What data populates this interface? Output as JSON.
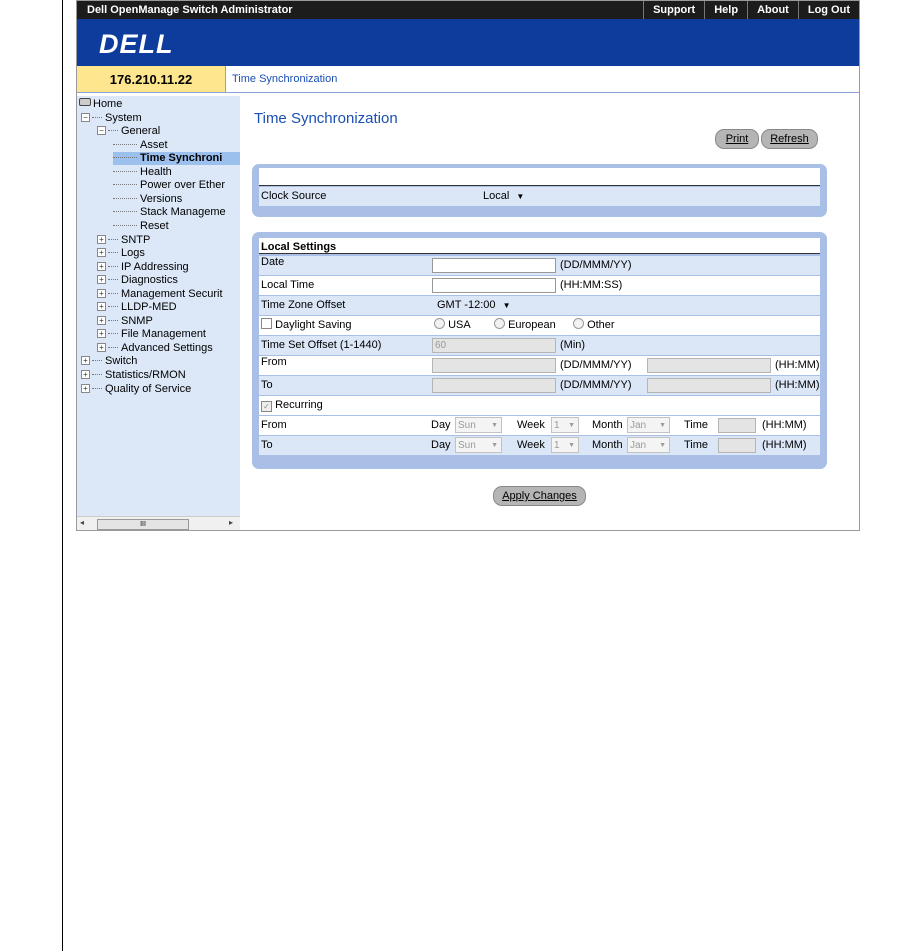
{
  "header": {
    "app_title": "Dell OpenManage Switch Administrator",
    "links": [
      "Support",
      "Help",
      "About",
      "Log Out"
    ],
    "logo_text": "DELL"
  },
  "ipbar": {
    "ip": "176.210.11.22",
    "breadcrumb": "Time Synchronization"
  },
  "tree": [
    {
      "label": "Home",
      "level": 0,
      "sign": "home"
    },
    {
      "label": "System",
      "level": 1,
      "sign": "-"
    },
    {
      "label": "General",
      "level": 2,
      "sign": "-"
    },
    {
      "label": "Asset",
      "level": 3,
      "sign": ""
    },
    {
      "label": "Time Synchroni",
      "level": 3,
      "sign": "",
      "selected": true
    },
    {
      "label": "Health",
      "level": 3,
      "sign": ""
    },
    {
      "label": "Power over Ether",
      "level": 3,
      "sign": ""
    },
    {
      "label": "Versions",
      "level": 3,
      "sign": ""
    },
    {
      "label": "Stack Manageme",
      "level": 3,
      "sign": ""
    },
    {
      "label": "Reset",
      "level": 3,
      "sign": ""
    },
    {
      "label": "SNTP",
      "level": 2,
      "sign": "+"
    },
    {
      "label": "Logs",
      "level": 2,
      "sign": "+"
    },
    {
      "label": "IP Addressing",
      "level": 2,
      "sign": "+"
    },
    {
      "label": "Diagnostics",
      "level": 2,
      "sign": "+"
    },
    {
      "label": "Management Securit",
      "level": 2,
      "sign": "+"
    },
    {
      "label": "LLDP-MED",
      "level": 2,
      "sign": "+"
    },
    {
      "label": "SNMP",
      "level": 2,
      "sign": "+"
    },
    {
      "label": "File Management",
      "level": 2,
      "sign": "+"
    },
    {
      "label": "Advanced Settings",
      "level": 2,
      "sign": "+"
    },
    {
      "label": "Switch",
      "level": 1,
      "sign": "+"
    },
    {
      "label": "Statistics/RMON",
      "level": 1,
      "sign": "+"
    },
    {
      "label": "Quality of Service",
      "level": 1,
      "sign": "+"
    }
  ],
  "scrollbar_thumb": "III",
  "page": {
    "title": "Time Synchronization",
    "print_label": "Print",
    "refresh_label": "Refresh",
    "apply_label": "Apply Changes"
  },
  "clock": {
    "label": "Clock Source",
    "value": "Local"
  },
  "local": {
    "heading": "Local Settings",
    "date_label": "Date",
    "date_unit": "(DD/MMM/YY)",
    "time_label": "Local Time",
    "time_unit": "(HH:MM:SS)",
    "tz_label": "Time Zone Offset",
    "tz_value": "GMT -12:00",
    "dst_label": "Daylight Saving",
    "dst_options": [
      "USA",
      "European",
      "Other"
    ],
    "offset_label": "Time Set Offset (1-1440)",
    "offset_value": "60",
    "offset_unit": "(Min)",
    "from_label": "From",
    "to_label": "To",
    "date_unit2": "(DD/MMM/YY)",
    "hhmm_unit": "(HH:MM)",
    "recurring_label": "Recurring",
    "rec_day_label": "Day",
    "rec_week_label": "Week",
    "rec_month_label": "Month",
    "rec_time_label": "Time",
    "rec_from": {
      "day": "Sun",
      "week": "1",
      "month": "Jan"
    },
    "rec_to": {
      "day": "Sun",
      "week": "1",
      "month": "Jan"
    }
  }
}
